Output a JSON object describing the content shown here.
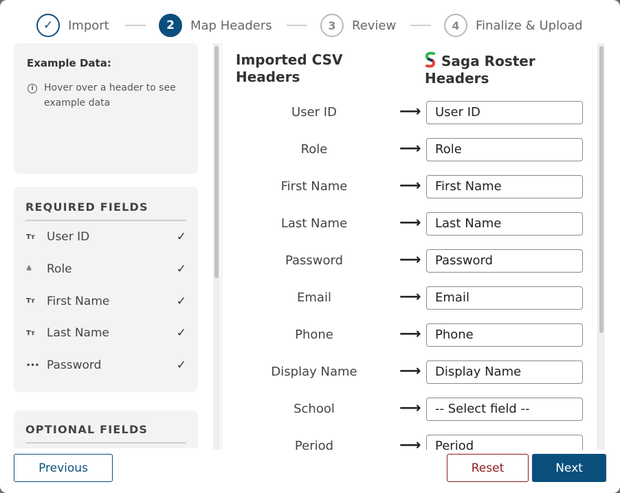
{
  "stepper": {
    "steps": [
      {
        "number": "✓",
        "label": "Import",
        "state": "done"
      },
      {
        "number": "2",
        "label": "Map Headers",
        "state": "active"
      },
      {
        "number": "3",
        "label": "Review",
        "state": "todo"
      },
      {
        "number": "4",
        "label": "Finalize & Upload",
        "state": "todo"
      }
    ]
  },
  "example": {
    "title": "Example Data:",
    "hint": "Hover over a header to see example data"
  },
  "required": {
    "title": "REQUIRED FIELDS",
    "fields": [
      {
        "icon": "Tт",
        "icon_name": "text-type-icon",
        "label": "User ID",
        "check": "✓"
      },
      {
        "icon": "≗",
        "icon_name": "role-icon",
        "label": "Role",
        "check": "✓"
      },
      {
        "icon": "Tт",
        "icon_name": "text-type-icon",
        "label": "First Name",
        "check": "✓"
      },
      {
        "icon": "Tт",
        "icon_name": "text-type-icon",
        "label": "Last Name",
        "check": "✓"
      },
      {
        "icon": "•••",
        "icon_name": "password-icon",
        "label": "Password",
        "check": "✓"
      }
    ]
  },
  "optional": {
    "title": "OPTIONAL FIELDS"
  },
  "mapping": {
    "left_header": "Imported CSV Headers",
    "right_header": "Saga Roster Headers",
    "arrow": "⟶",
    "rows": [
      {
        "source": "User ID",
        "target": "User ID"
      },
      {
        "source": "Role",
        "target": "Role"
      },
      {
        "source": "First Name",
        "target": "First Name"
      },
      {
        "source": "Last Name",
        "target": "Last Name"
      },
      {
        "source": "Password",
        "target": "Password"
      },
      {
        "source": "Email",
        "target": "Email"
      },
      {
        "source": "Phone",
        "target": "Phone"
      },
      {
        "source": "Display Name",
        "target": "Display Name"
      },
      {
        "source": "School",
        "target": "-- Select field --"
      },
      {
        "source": "Period",
        "target": "Period"
      }
    ]
  },
  "footer": {
    "previous": "Previous",
    "reset": "Reset",
    "next": "Next"
  },
  "colors": {
    "primary": "#0b4f7c",
    "danger": "#8b1a1a",
    "logo_green": "#2db34a",
    "logo_red": "#e0443a",
    "logo_navy": "#1a3a5c"
  }
}
